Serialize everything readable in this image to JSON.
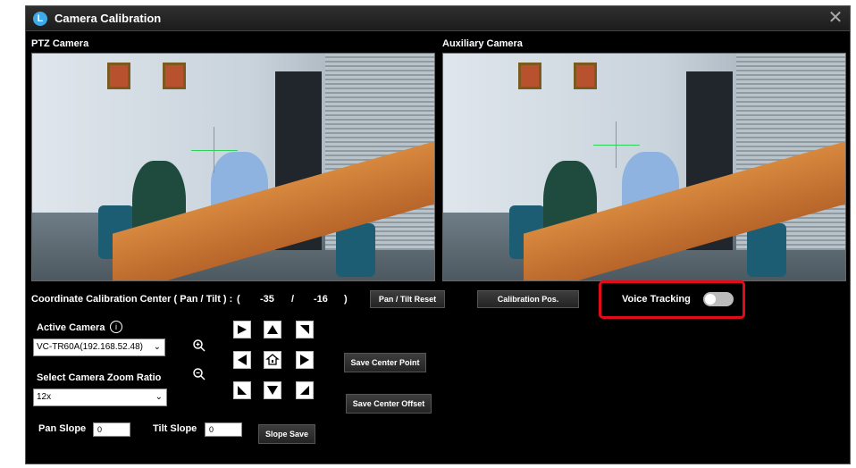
{
  "window": {
    "title": "Camera Calibration",
    "close_glyph": "✕"
  },
  "cameras": {
    "ptz_label": "PTZ Camera",
    "aux_label": "Auxiliary Camera"
  },
  "calibration": {
    "label": "Coordinate Calibration Center ( Pan / Tilt ) :",
    "open_paren": "(",
    "pan": "-35",
    "sep": "/",
    "tilt": "-16",
    "close_paren": ")",
    "reset_button": "Pan / Tilt Reset",
    "calib_pos_button": "Calibration Pos."
  },
  "voice_tracking": {
    "label": "Voice Tracking",
    "enabled": false
  },
  "active_camera": {
    "label": "Active Camera",
    "info_icon": "i",
    "value": "VC-TR60A(192.168.52.48)"
  },
  "zoom": {
    "label": "Select Camera Zoom Ratio",
    "value": "12x"
  },
  "buttons": {
    "save_center_point": "Save Center Point",
    "save_center_offset": "Save Center Offset",
    "slope_save": "Slope Save"
  },
  "slope": {
    "pan_label": "Pan Slope",
    "pan_value": "0",
    "tilt_label": "Tilt Slope",
    "tilt_value": "0"
  },
  "colors": {
    "accent_green": "#2fd15a",
    "highlight_red": "#e30b1a"
  }
}
